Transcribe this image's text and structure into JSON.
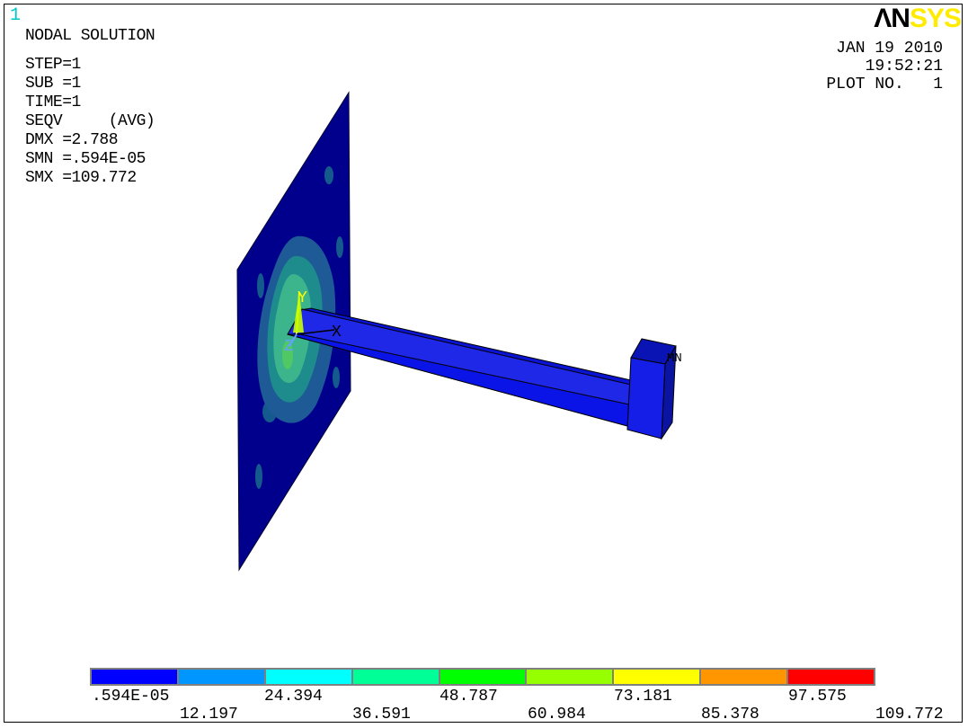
{
  "window_number": "1",
  "logo": {
    "part1": "ΛN",
    "part2": "SYS"
  },
  "info_left": [
    "NODAL SOLUTION",
    "STEP=1",
    "SUB =1",
    "TIME=1",
    "SEQV     (AVG)",
    "DMX =2.788",
    "SMN =.594E-05",
    "SMX =109.772"
  ],
  "info_right": {
    "date": "JAN 19 2010",
    "time": "19:52:21",
    "plot": "PLOT NO.   1"
  },
  "axis_labels": {
    "y": "Y",
    "x": "X",
    "z": "Z",
    "mn": "MN"
  },
  "legend": {
    "colors": [
      "#0000ff",
      "#0096ff",
      "#00ffff",
      "#00ff96",
      "#00ff00",
      "#96ff00",
      "#ffff00",
      "#ff9600",
      "#ff0000"
    ],
    "labels_top": [
      ".594E-05",
      "24.394",
      "48.787",
      "73.181",
      "97.575"
    ],
    "labels_bottom": [
      "12.197",
      "36.591",
      "60.984",
      "85.378",
      "109.772"
    ]
  }
}
